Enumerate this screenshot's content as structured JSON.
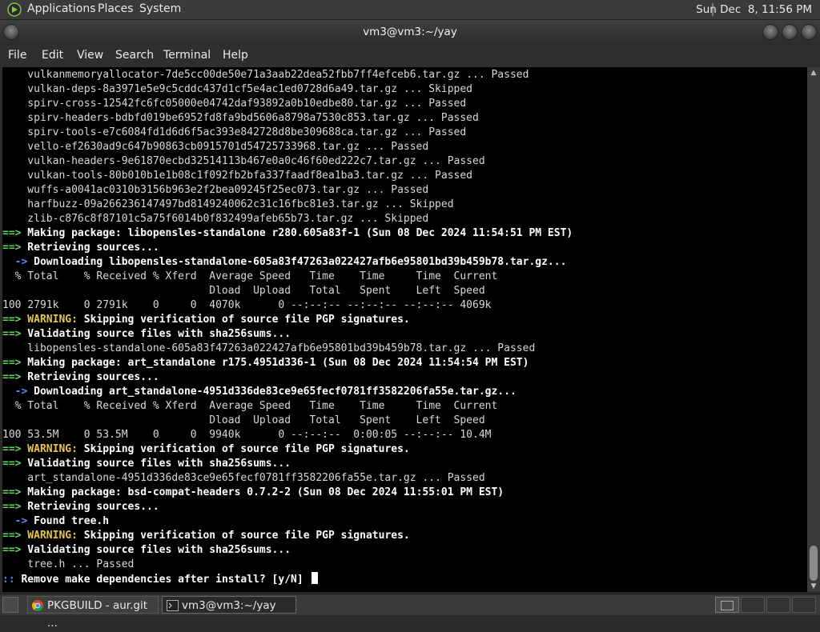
{
  "panel": {
    "menus": [
      "Applications",
      "Places",
      "System"
    ],
    "clock": "Sun Dec  8, 11:56 PM"
  },
  "window": {
    "title": "vm3@vm3:~/yay"
  },
  "menubar": [
    "File",
    "Edit",
    "View",
    "Search",
    "Terminal",
    "Help"
  ],
  "terminal": {
    "lines": [
      [
        "",
        "    vulkanmemoryallocator-7de5cc00de50e71a3aab22dea52fbb7ff4efceb6.tar.gz ... Passed"
      ],
      [
        "",
        "    vulkan-deps-8a3971e5e9c5cddc437d1cf5e4ac1ed0728d6a49.tar.gz ... Skipped"
      ],
      [
        "",
        "    spirv-cross-12542fc6fc05000e04742daf93892a0b10edbe80.tar.gz ... Passed"
      ],
      [
        "",
        "    spirv-headers-bdbfd019be6952fd8fa9bd5606a8798a7530c853.tar.gz ... Passed"
      ],
      [
        "",
        "    spirv-tools-e7c6084fd1d6d6f5ac393e842728d8be309688ca.tar.gz ... Passed"
      ],
      [
        "",
        "    vello-ef2630ad9c647b90863cb0915701d54725733968.tar.gz ... Passed"
      ],
      [
        "",
        "    vulkan-headers-9e61870ecbd32514113b467e0a0c46f60ed222c7.tar.gz ... Passed"
      ],
      [
        "",
        "    vulkan-tools-80b010b1e1b08c1f092fb2bfa337faadf8ea1ba3.tar.gz ... Passed"
      ],
      [
        "",
        "    wuffs-a0041ac0310b3156b963e2f2bea09245f25ec073.tar.gz ... Passed"
      ],
      [
        "",
        "    harfbuzz-09a266236147497bd8149240062c31c16fbc81e3.tar.gz ... Skipped"
      ],
      [
        "",
        "    zlib-c876c8f87101c5a75f6014b0f832499afeb65b73.tar.gz ... Skipped"
      ],
      [
        "==>",
        " Making package: libopensles-standalone r280.605a83f-1 (Sun 08 Dec 2024 11:54:51 PM EST)"
      ],
      [
        "==>",
        " Retrieving sources..."
      ],
      [
        "  ->",
        " Downloading libopensles-standalone-605a83f47263a022427afb6e95801bd39b459b78.tar.gz..."
      ],
      [
        "",
        "  % Total    % Received % Xferd  Average Speed   Time    Time     Time  Current"
      ],
      [
        "",
        "                                 Dload  Upload   Total   Spent    Left  Speed"
      ],
      [
        "",
        "100 2791k    0 2791k    0     0  4070k      0 --:--:-- --:--:-- --:--:-- 4069k"
      ],
      [
        "==>",
        " WARNING: Skipping verification of source file PGP signatures."
      ],
      [
        "==>",
        " Validating source files with sha256sums..."
      ],
      [
        "",
        "    libopensles-standalone-605a83f47263a022427afb6e95801bd39b459b78.tar.gz ... Passed"
      ],
      [
        "==>",
        " Making package: art_standalone r175.4951d336-1 (Sun 08 Dec 2024 11:54:54 PM EST)"
      ],
      [
        "==>",
        " Retrieving sources..."
      ],
      [
        "  ->",
        " Downloading art_standalone-4951d336de83ce9e65fecf0781ff3582206fa55e.tar.gz..."
      ],
      [
        "",
        "  % Total    % Received % Xferd  Average Speed   Time    Time     Time  Current"
      ],
      [
        "",
        "                                 Dload  Upload   Total   Spent    Left  Speed"
      ],
      [
        "",
        "100 53.5M    0 53.5M    0     0  9940k      0 --:--:--  0:00:05 --:--:-- 10.4M"
      ],
      [
        "==>",
        " WARNING: Skipping verification of source file PGP signatures."
      ],
      [
        "==>",
        " Validating source files with sha256sums..."
      ],
      [
        "",
        "    art_standalone-4951d336de83ce9e65fecf0781ff3582206fa55e.tar.gz ... Passed"
      ],
      [
        "==>",
        " Making package: bsd-compat-headers 0.7.2-2 (Sun 08 Dec 2024 11:55:01 PM EST)"
      ],
      [
        "==>",
        " Retrieving sources..."
      ],
      [
        "  ->",
        " Found tree.h"
      ],
      [
        "==>",
        " WARNING: Skipping verification of source file PGP signatures."
      ],
      [
        "==>",
        " Validating source files with sha256sums..."
      ],
      [
        "",
        "    tree.h ... Passed"
      ],
      [
        ":: ",
        "Remove make dependencies after install? [y/N] "
      ]
    ]
  },
  "taskbar": {
    "tasks": [
      "PKGBUILD - aur.git ...",
      "vm3@vm3:~/yay"
    ]
  }
}
